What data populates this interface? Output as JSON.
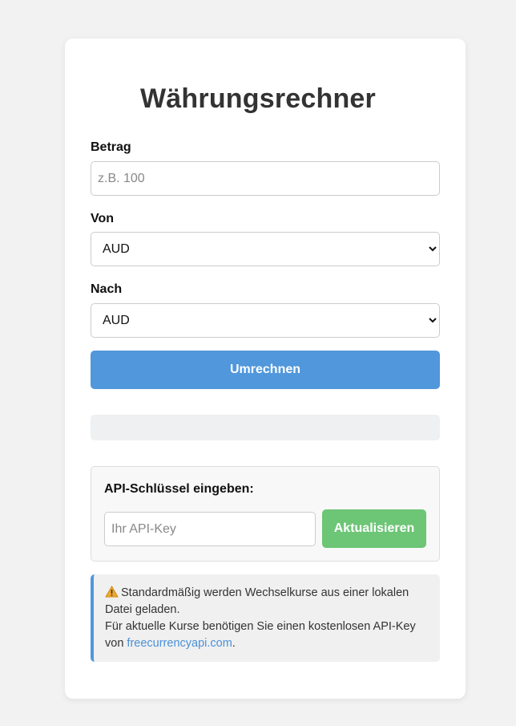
{
  "title": "Währungsrechner",
  "form": {
    "amount_label": "Betrag",
    "amount_placeholder": "z.B. 100",
    "from_label": "Von",
    "from_value": "AUD",
    "to_label": "Nach",
    "to_value": "AUD",
    "convert_button": "Umrechnen",
    "result_text": ""
  },
  "api": {
    "title": "API-Schlüssel eingeben:",
    "input_placeholder": "Ihr API-Key",
    "update_button": "Aktualisieren"
  },
  "notice": {
    "icon": "warning-icon",
    "line1": "Standardmäßig werden Wechselkurse aus einer lokalen Datei geladen.",
    "line2_prefix": "Für aktuelle Kurse benötigen Sie einen kostenlosen API-Key von ",
    "link_text": "freecurrencyapi.com",
    "line2_suffix": "."
  },
  "colors": {
    "background": "#f2f2f2",
    "primary_button": "#5197db",
    "success_button": "#6dc576",
    "notice_accent": "#5197db"
  }
}
